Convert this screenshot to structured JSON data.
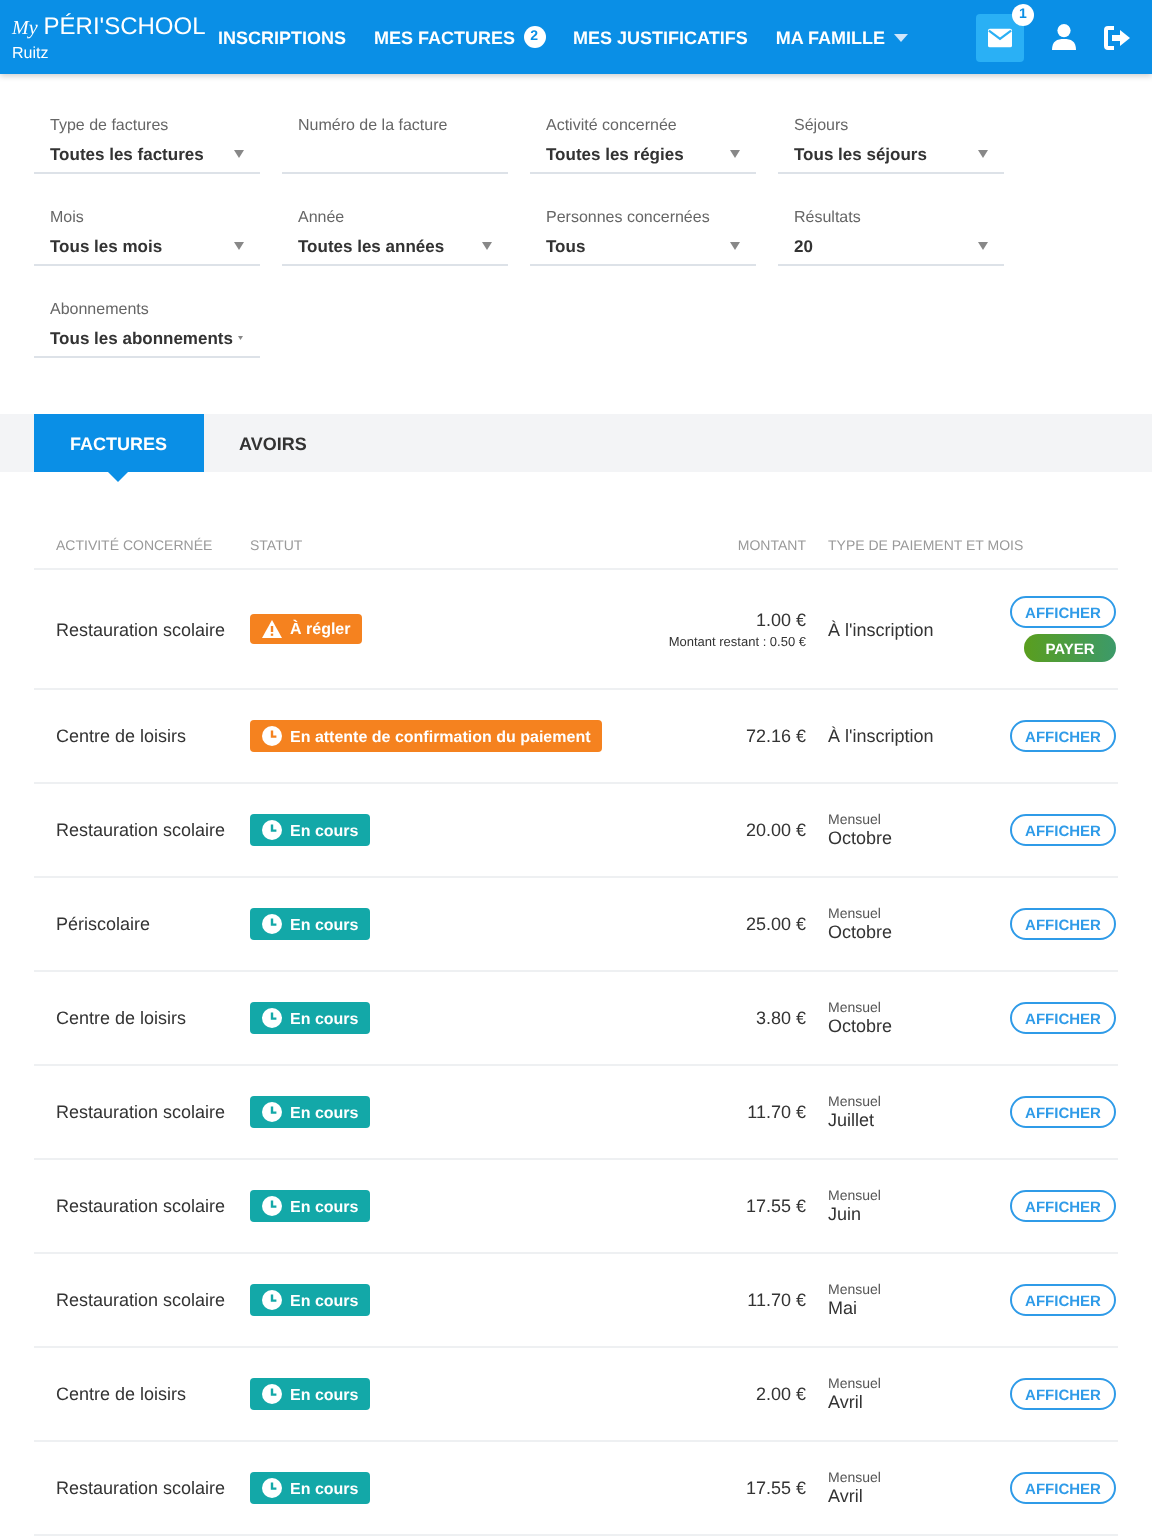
{
  "header": {
    "logo_prefix": "My",
    "logo": "PÉRI'SCHOOL",
    "town": "Ruitz",
    "nav": [
      {
        "label": "INSCRIPTIONS",
        "dropdown": false
      },
      {
        "label": "MES FACTURES",
        "badge": "2",
        "dropdown": false
      },
      {
        "label": "MES JUSTIFICATIFS",
        "dropdown": false
      },
      {
        "label": "MA FAMILLE",
        "dropdown": true
      }
    ],
    "mail_badge": "1"
  },
  "filters": [
    {
      "label": "Type de factures",
      "value": "Toutes les factures",
      "kind": "select"
    },
    {
      "label": "Numéro de la facture",
      "kind": "text"
    },
    {
      "label": "Activité concernée",
      "value": "Toutes les régies",
      "kind": "select"
    },
    {
      "label": "Séjours",
      "value": "Tous les séjours",
      "kind": "select"
    },
    {
      "label": "Mois",
      "value": "Tous les mois",
      "kind": "select"
    },
    {
      "label": "Année",
      "value": "Toutes les années",
      "kind": "select"
    },
    {
      "label": "Personnes concernées",
      "value": "Tous",
      "kind": "select"
    },
    {
      "label": "Résultats",
      "value": "20",
      "kind": "select"
    },
    {
      "label": "Abonnements",
      "value": "Tous les abonnements",
      "kind": "select"
    }
  ],
  "tabs": [
    {
      "label": "FACTURES",
      "selected": true
    },
    {
      "label": "AVOIRS",
      "selected": false
    }
  ],
  "table": {
    "columns": [
      "ACTIVITÉ CONCERNÉE",
      "STATUT",
      "MONTANT",
      "TYPE DE PAIEMENT ET MOIS"
    ],
    "rows": [
      {
        "activity": "Restauration scolaire",
        "status": {
          "kind": "warning",
          "label": "À régler"
        },
        "amount": "1.00 €",
        "remaining": "Montant restant : 0.50 €",
        "period": "À l'inscription",
        "actions": [
          "AFFICHER",
          "PAYER"
        ]
      },
      {
        "activity": "Centre de loisirs",
        "status": {
          "kind": "pending",
          "label": "En attente de confirmation du paiement"
        },
        "amount": "72.16 €",
        "period": "À l'inscription",
        "actions": [
          "AFFICHER"
        ]
      },
      {
        "activity": "Restauration scolaire",
        "status": {
          "kind": "ongoing",
          "label": "En cours"
        },
        "amount": "20.00 €",
        "payment_type": "Mensuel",
        "period": "Octobre",
        "actions": [
          "AFFICHER"
        ]
      },
      {
        "activity": "Périscolaire",
        "status": {
          "kind": "ongoing",
          "label": "En cours"
        },
        "amount": "25.00 €",
        "payment_type": "Mensuel",
        "period": "Octobre",
        "actions": [
          "AFFICHER"
        ]
      },
      {
        "activity": "Centre de loisirs",
        "status": {
          "kind": "ongoing",
          "label": "En cours"
        },
        "amount": "3.80 €",
        "payment_type": "Mensuel",
        "period": "Octobre",
        "actions": [
          "AFFICHER"
        ]
      },
      {
        "activity": "Restauration scolaire",
        "status": {
          "kind": "ongoing",
          "label": "En cours"
        },
        "amount": "11.70 €",
        "payment_type": "Mensuel",
        "period": "Juillet",
        "actions": [
          "AFFICHER"
        ]
      },
      {
        "activity": "Restauration scolaire",
        "status": {
          "kind": "ongoing",
          "label": "En cours"
        },
        "amount": "17.55 €",
        "payment_type": "Mensuel",
        "period": "Juin",
        "actions": [
          "AFFICHER"
        ]
      },
      {
        "activity": "Restauration scolaire",
        "status": {
          "kind": "ongoing",
          "label": "En cours"
        },
        "amount": "11.70 €",
        "payment_type": "Mensuel",
        "period": "Mai",
        "actions": [
          "AFFICHER"
        ]
      },
      {
        "activity": "Centre de loisirs",
        "status": {
          "kind": "ongoing",
          "label": "En cours"
        },
        "amount": "2.00 €",
        "payment_type": "Mensuel",
        "period": "Avril",
        "actions": [
          "AFFICHER"
        ]
      },
      {
        "activity": "Restauration scolaire",
        "status": {
          "kind": "ongoing",
          "label": "En cours"
        },
        "amount": "17.55 €",
        "payment_type": "Mensuel",
        "period": "Avril",
        "actions": [
          "AFFICHER"
        ]
      }
    ]
  }
}
